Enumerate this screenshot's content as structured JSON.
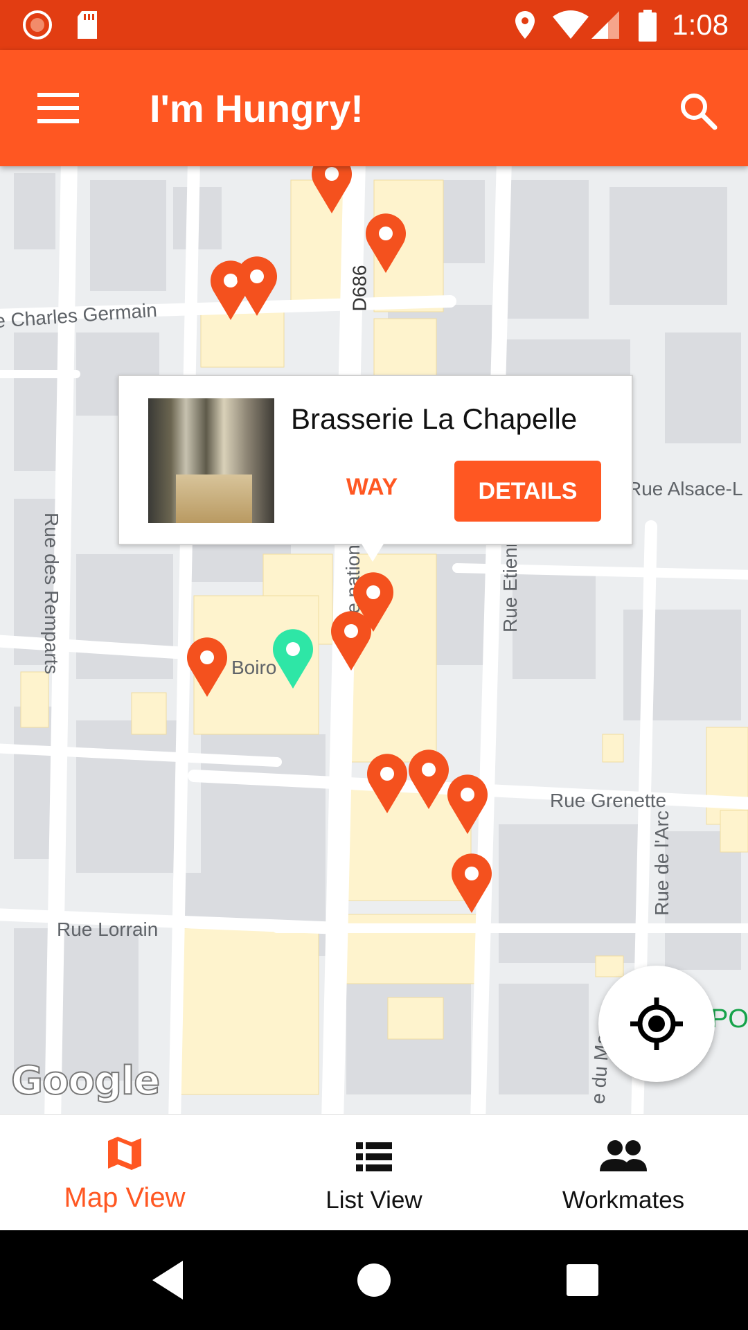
{
  "status_bar": {
    "time": "1:08"
  },
  "app_bar": {
    "title": "I'm Hungry!"
  },
  "map": {
    "street_labels": [
      "e Charles Germain",
      "D686",
      "Rue des Remparts",
      "Rue Alsace-L",
      "e nation",
      "Rue Etienne",
      "Boiro",
      "Rue Grenette",
      "Rue de l'Arc",
      "Rue Lorrain",
      "e du Mac",
      "POI"
    ],
    "attribution": "Google"
  },
  "info_window": {
    "restaurant_name": "Brasserie La Chapelle",
    "way_label": "WAY",
    "details_label": "DETAILS"
  },
  "colors": {
    "primary": "#ff5722",
    "status_bar": "#e23d12",
    "selected_pin": "#2ee6a6"
  },
  "bottom_nav": {
    "items": [
      {
        "label": "Map View",
        "icon": "map-icon",
        "active": true
      },
      {
        "label": "List View",
        "icon": "list-icon",
        "active": false
      },
      {
        "label": "Workmates",
        "icon": "people-icon",
        "active": false
      }
    ]
  }
}
